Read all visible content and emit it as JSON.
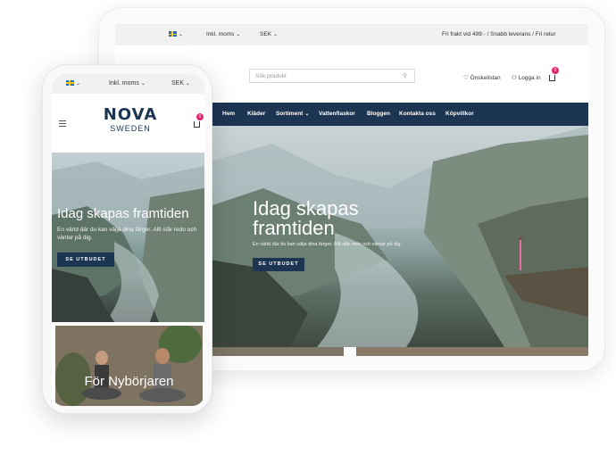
{
  "tablet": {
    "topbar": {
      "tax_label": "Inkl. moms",
      "currency": "SEK",
      "shipping_note": "Fri frakt vid 499:- / Snabb leverans / Fri retur"
    },
    "search": {
      "placeholder": "Sök produkt"
    },
    "wishlist_label": "Önskelistan",
    "login_label": "Logga in",
    "cart_count": "0",
    "nav": [
      "Hem",
      "Kläder",
      "Sortiment",
      "Vattenflaskor",
      "Bloggen",
      "Kontakta oss",
      "Köpvillkor"
    ],
    "hero": {
      "title": "Idag skapas framtiden",
      "subtitle": "En värld där du kan välja dina färger. Allt står redo och väntar på dig.",
      "button": "SE UTBUDET"
    }
  },
  "phone": {
    "topbar": {
      "tax_label": "Inkl. moms",
      "currency": "SEK"
    },
    "logo": {
      "main": "NOVA",
      "sub": "SWEDEN"
    },
    "cart_count": "0",
    "hero": {
      "title": "Idag skapas framtiden",
      "subtitle": "En värld där du kan välja dina färger. Allt står redo och väntar på dig.",
      "button": "SE UTBUDET"
    },
    "card": {
      "title": "För Nybörjaren"
    }
  },
  "colors": {
    "navy": "#1c3552",
    "badge": "#e2226d",
    "topbar": "#f1f1f1"
  }
}
